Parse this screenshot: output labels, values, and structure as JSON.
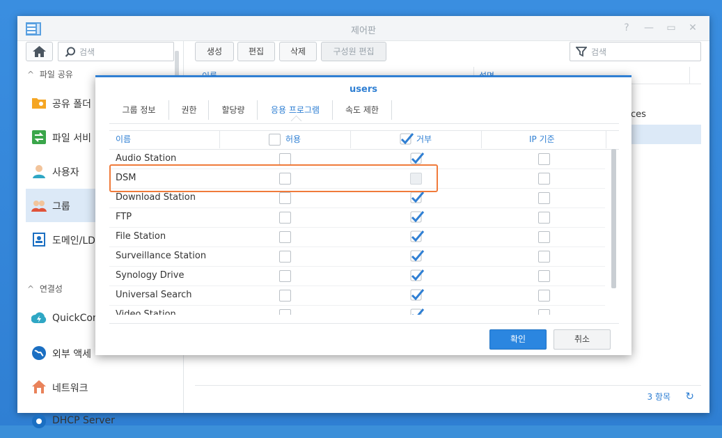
{
  "window": {
    "title": "제어판"
  },
  "window_controls": [
    "?",
    "—",
    "▭",
    "✕"
  ],
  "left_search": {
    "placeholder": "검색"
  },
  "left_nav": {
    "section_file_sharing": "파일 공유",
    "section_connectivity": "연결성",
    "items": [
      {
        "label": "공유 폴더",
        "icon": "folder-share-icon"
      },
      {
        "label": "파일 서비",
        "icon": "file-services-icon"
      },
      {
        "label": "사용자",
        "icon": "user-icon"
      },
      {
        "label": "그룹",
        "icon": "group-icon"
      },
      {
        "label": "도메인/LD",
        "icon": "domain-ldap-icon"
      },
      {
        "label": "QuickCon",
        "icon": "quickconnect-icon"
      },
      {
        "label": "외부 액세",
        "icon": "external-access-icon"
      },
      {
        "label": "네트워크",
        "icon": "network-icon"
      },
      {
        "label": "DHCP Server",
        "icon": "dhcp-server-icon"
      }
    ]
  },
  "toolbar": {
    "create": "생성",
    "edit": "편집",
    "delete": "삭제",
    "edit_members": "구성원 편집"
  },
  "right_search": {
    "placeholder": "검색"
  },
  "group_grid": {
    "columns": [
      "이름",
      "설명"
    ],
    "visible_fragment": "ces"
  },
  "footer": {
    "count": "3 항목"
  },
  "dialog": {
    "title": "users",
    "tabs": [
      "그룹 정보",
      "권한",
      "할당량",
      "응용 프로그램",
      "속도 제한"
    ],
    "active_tab": "응용 프로그램",
    "columns": {
      "name": "이름",
      "allow": "허용",
      "deny": "거부",
      "ip": "IP 기준"
    },
    "rows": [
      {
        "name": "Audio Station",
        "allow": false,
        "deny": true,
        "ip": false
      },
      {
        "name": "DSM",
        "allow": false,
        "deny": false,
        "ip": false
      },
      {
        "name": "Download Station",
        "allow": false,
        "deny": true,
        "ip": false
      },
      {
        "name": "FTP",
        "allow": false,
        "deny": true,
        "ip": false
      },
      {
        "name": "File Station",
        "allow": false,
        "deny": true,
        "ip": false
      },
      {
        "name": "Surveillance Station",
        "allow": false,
        "deny": true,
        "ip": false
      },
      {
        "name": "Synology Drive",
        "allow": false,
        "deny": true,
        "ip": false
      },
      {
        "name": "Universal Search",
        "allow": false,
        "deny": true,
        "ip": false
      },
      {
        "name": "Video Station",
        "allow": false,
        "deny": true,
        "ip": false
      }
    ],
    "ok_label": "확인",
    "cancel_label": "취소"
  },
  "colors": {
    "accent": "#2f7fd3",
    "highlight": "#f07a3a",
    "selected_row": "#dce9f7"
  }
}
